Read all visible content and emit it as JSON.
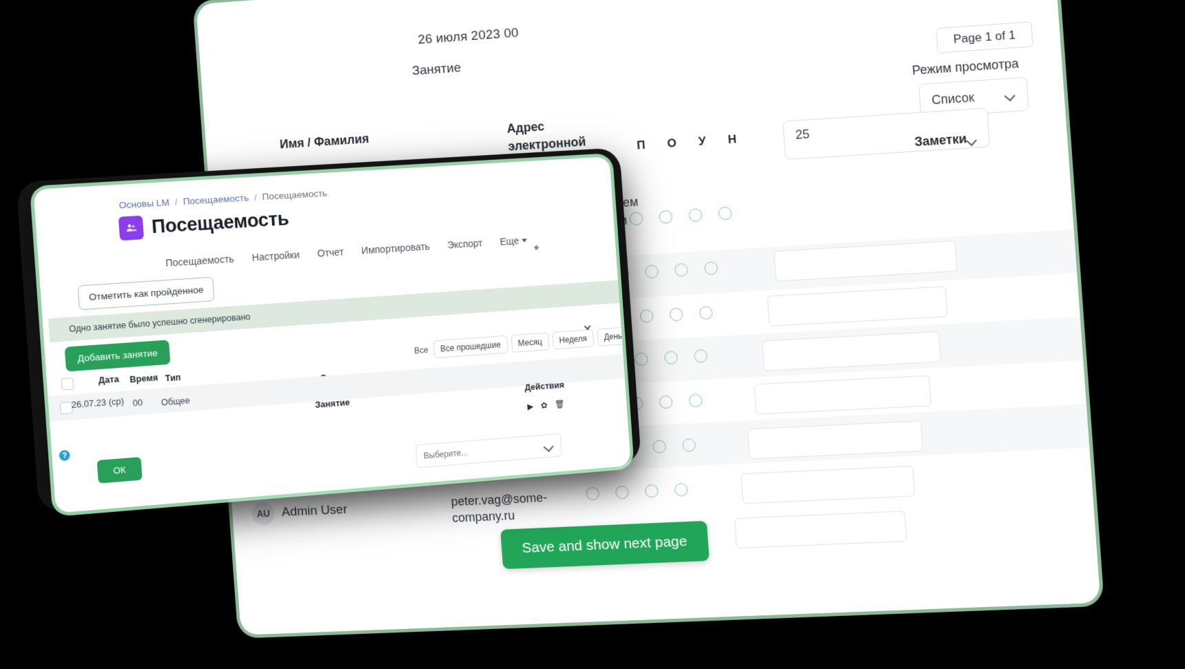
{
  "back_window": {
    "date_header": "26 июля 2023 00",
    "lesson_label": "Занятие",
    "page_indicator": "Page 1 of 1",
    "view_mode_label": "Режим просмотра",
    "view_mode_value": "Список",
    "per_page_value": "25",
    "columns": {
      "name": "Имя / Фамилия",
      "email": "Адрес электронной почты",
      "notes": "Заметки"
    },
    "status_letters": [
      "П",
      "О",
      "У",
      "Н"
    ],
    "set_all_label": "Задать статус всем пользователям",
    "save_button": "Save and show next page",
    "user": {
      "initials": "AU",
      "name": "Admin User",
      "email_line1": "peter.vag@some-",
      "email_line2": "company.ru"
    },
    "accent_green": "#21a558",
    "radio_border": "#86c9a2"
  },
  "front_window": {
    "breadcrumb": {
      "root": "Основы LM",
      "middle": "Посещаемость",
      "current": "Посещаемость",
      "separator": "/"
    },
    "title": "Посещаемость",
    "app_icon": "attendance-app-icon",
    "tabs": [
      {
        "label": "Посещаемость"
      },
      {
        "label": "Настройки"
      },
      {
        "label": "Отчет"
      },
      {
        "label": "Импортировать"
      },
      {
        "label": "Экспорт"
      },
      {
        "label": "Еще"
      }
    ],
    "mark_passed_button": "Отметить как пройденное",
    "alert_message": "Одно занятие было успешно сгенерировано",
    "add_lesson_button": "Добавить занятие",
    "close_label": "✕",
    "table": {
      "headers": {
        "date": "Дата",
        "time": "Время",
        "type": "Тип",
        "description": "Описание",
        "lesson": "Занятие",
        "actions": "Действия"
      },
      "row": {
        "date": "26.07.23 (ср)",
        "time": "00",
        "type": "Общее"
      }
    },
    "filters": {
      "label": "Все",
      "buttons": [
        "Все прошедшие",
        "Месяц",
        "Неделя",
        "День"
      ]
    },
    "action_icons": [
      "play-icon",
      "gear-icon",
      "trash-icon"
    ],
    "select_placeholder": "Выберите...",
    "help_icon": "help-icon",
    "ok_button": "ОК",
    "icon_purple": "#8b3fe8",
    "accent_green": "#28a05a"
  }
}
